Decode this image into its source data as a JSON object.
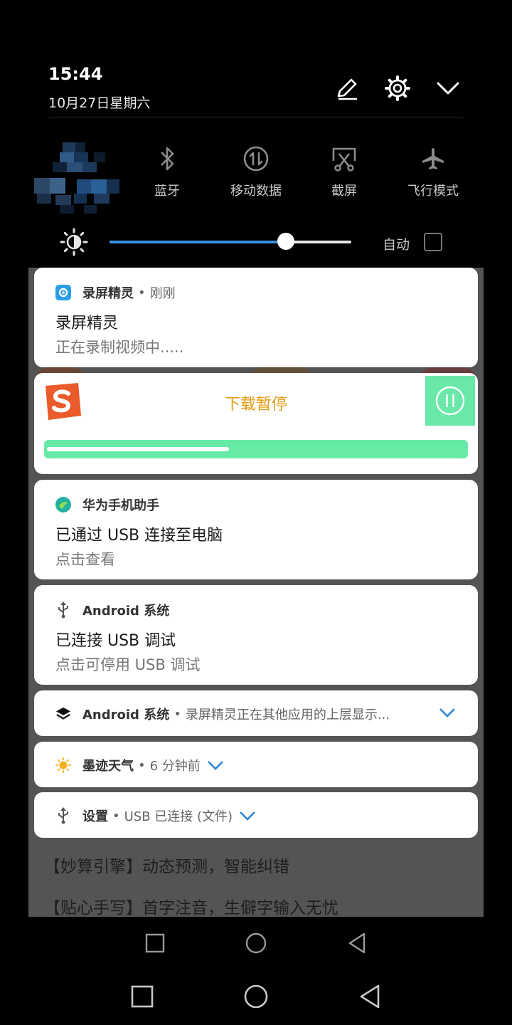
{
  "status": {
    "time": "15:44",
    "date": "10月27日星期六"
  },
  "header_icons": [
    "edit-icon",
    "settings-gear-icon",
    "collapse-chevron-icon"
  ],
  "quick_settings": [
    {
      "label": "蓝牙",
      "icon": "bluetooth-icon"
    },
    {
      "label": "移动数据",
      "icon": "mobile-data-icon"
    },
    {
      "label": "截屏",
      "icon": "screenshot-icon"
    },
    {
      "label": "飞行模式",
      "icon": "airplane-icon"
    }
  ],
  "brightness": {
    "level": 0.73,
    "auto_label": "自动",
    "auto_checked": false
  },
  "notifications": {
    "recorder": {
      "app": "录屏精灵",
      "time": "刚刚",
      "title": "录屏精灵",
      "text": "正在录制视频中....."
    },
    "download": {
      "status": "下载暂停",
      "progress": 0.43
    },
    "huawei": {
      "app": "华为手机助手",
      "title": "已通过 USB 连接至电脑",
      "text": "点击查看"
    },
    "android_usb": {
      "app": "Android 系统",
      "title": "已连接 USB 调试",
      "text": "点击可停用 USB 调试"
    },
    "android_overlay": {
      "app": "Android 系统",
      "summary": "录屏精灵正在其他应用的上层显示..."
    },
    "weather": {
      "app": "墨迹天气",
      "time": "6 分钟前"
    },
    "settings": {
      "app": "设置",
      "summary": "USB 已连接 (文件)"
    },
    "separator": "•"
  },
  "background_text": {
    "line1": "【妙算引擎】动态预测，智能纠错",
    "line2": "【贴心手写】首字注音，生僻字输入无忧"
  },
  "colors": {
    "accent_blue": "#3d8fe0",
    "download_green": "#66eaa6",
    "download_orange": "#e39a12"
  }
}
